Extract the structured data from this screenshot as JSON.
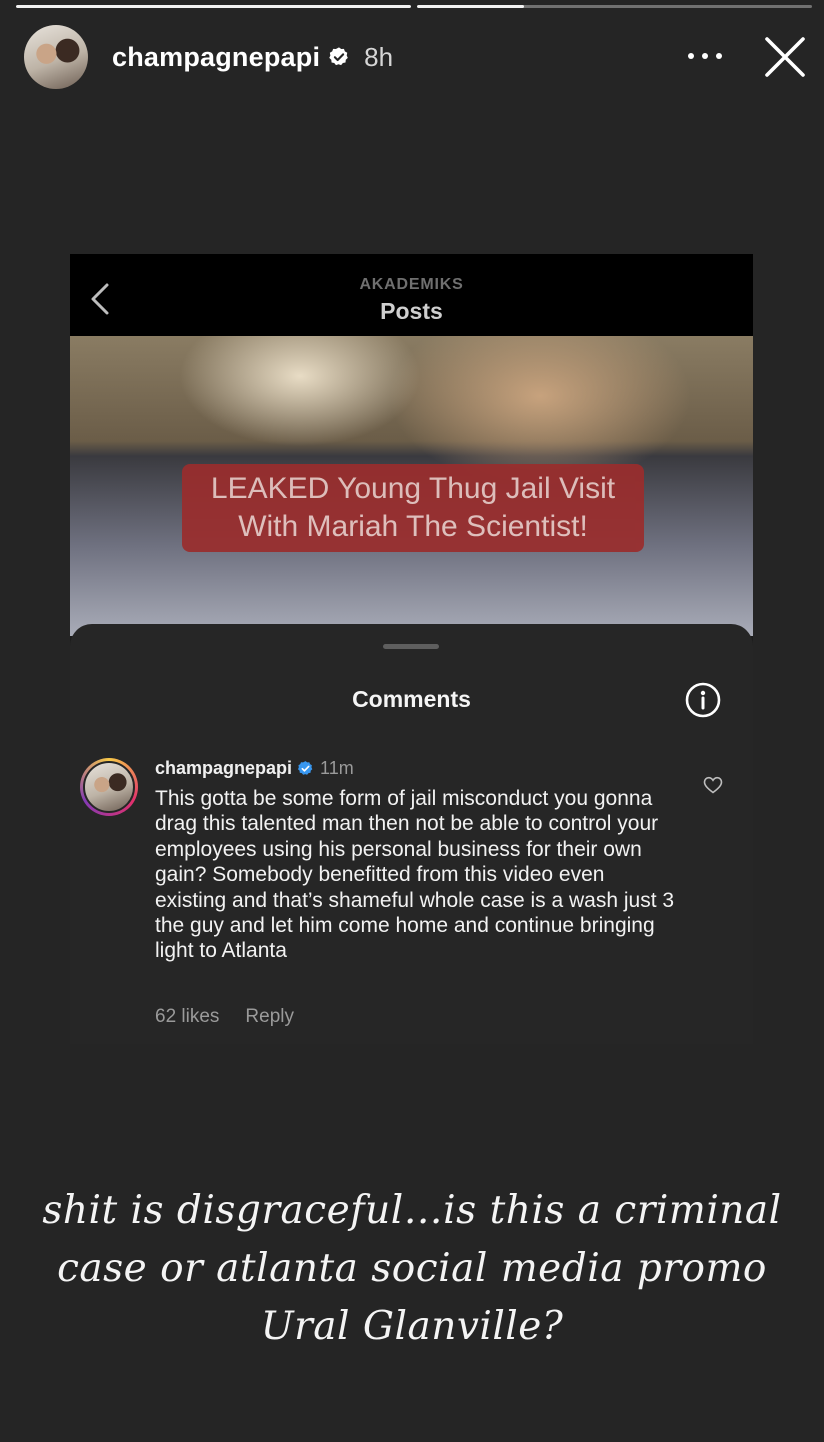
{
  "story": {
    "progress_segments": [
      1.0,
      0.27
    ]
  },
  "header": {
    "username": "champagnepapi",
    "posted_ago": "8h",
    "icons": {
      "verified": "verified-badge-icon",
      "more": "more-options-icon",
      "close": "close-icon"
    }
  },
  "screenshot": {
    "account": "AKADEMIKS",
    "title": "Posts",
    "video_label_line1": "LEAKED Young Thug Jail Visit",
    "video_label_line2": "With Mariah The Scientist!",
    "comments_title": "Comments",
    "comment": {
      "username": "champagnepapi",
      "time": "11m",
      "text": "This gotta be some form of jail misconduct you gonna drag this talented man then not be able to control your employees using his personal business for  their own gain? Somebody benefitted from this video even existing and that’s shameful whole case is a wash just 3 the guy and let him come home and continue bringing light to Atlanta",
      "likes": "62 likes",
      "reply": "Reply"
    }
  },
  "caption": "shit is disgraceful…is this a criminal case or atlanta social media promo Ural Glanville?",
  "colors": {
    "background": "#252525",
    "verified": "#3897f0",
    "label_red": "#9a2d2d"
  }
}
